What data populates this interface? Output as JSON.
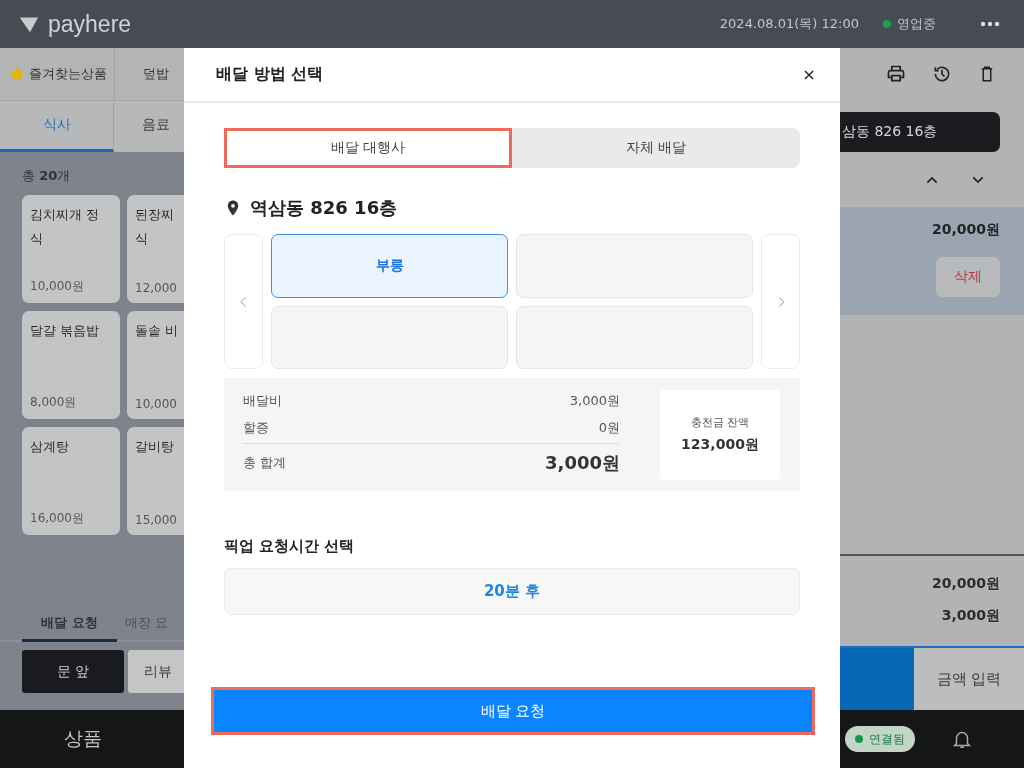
{
  "header": {
    "logo": "payhere",
    "datetime": "2024.08.01(목) 12:00",
    "status": "영업중"
  },
  "left_panel": {
    "categories": [
      {
        "label": "즐겨찾는상품",
        "kind": "favorite"
      },
      {
        "label": "덮밥",
        "kind": "plain"
      }
    ],
    "tabs": [
      {
        "label": "식사",
        "selected": true
      },
      {
        "label": "음료",
        "selected": false
      }
    ],
    "count": "총 **20**개",
    "products": [
      {
        "lines": [
          "김치찌개 정",
          "식"
        ],
        "price": "10,000원"
      },
      {
        "lines": [
          "된장찌",
          "식"
        ],
        "price": "12,000"
      },
      {
        "lines": [
          "달걀 볶음밥"
        ],
        "price": "8,000원"
      },
      {
        "lines": [
          "돌솥 비"
        ],
        "price": "10,000"
      },
      {
        "lines": [
          "삼계탕"
        ],
        "price": "16,000원"
      },
      {
        "lines": [
          "갈비탕"
        ],
        "price": "15,000"
      }
    ],
    "order_tabs": [
      {
        "label": "배달 요청",
        "selected": true
      },
      {
        "label": "매장 요",
        "selected": false
      }
    ],
    "options": [
      {
        "label": "문 앞",
        "selected": true
      },
      {
        "label": "리뷰",
        "selected": false
      }
    ],
    "nav": "상품"
  },
  "modal": {
    "title": "배달 방법 선택",
    "tabs": [
      {
        "label": "배달 대행사",
        "selected": true,
        "highlighted": true
      },
      {
        "label": "자체 배달",
        "selected": false,
        "highlighted": false
      }
    ],
    "address": "역삼동 826 16층",
    "carriers": [
      {
        "label": "부릉",
        "selected": true
      },
      {
        "selected": false
      },
      {
        "selected": false
      },
      {
        "selected": false
      }
    ],
    "fees": [
      {
        "label": "배달비",
        "value": "3,000원",
        "kind": "normal"
      },
      {
        "label": "할증",
        "value": "0원",
        "kind": "normal"
      },
      {
        "label": "총 합계",
        "value": "3,000원",
        "kind": "total"
      }
    ],
    "balance": {
      "label": "충전금 잔액",
      "value": "123,000원"
    },
    "pickup_title": "픽업 요청시간 선택",
    "pickup_time": "20분 후",
    "submit": {
      "label": "배달 요청",
      "highlighted": true
    }
  },
  "right_panel": {
    "address_chip": "삼동 826 16층",
    "order_item": {
      "price": "20,000원",
      "delete": "삭제",
      "selected": true
    },
    "totals": [
      "20,000원",
      "3,000원"
    ],
    "amount_button": "금액 입력",
    "connection": "연결됨"
  }
}
